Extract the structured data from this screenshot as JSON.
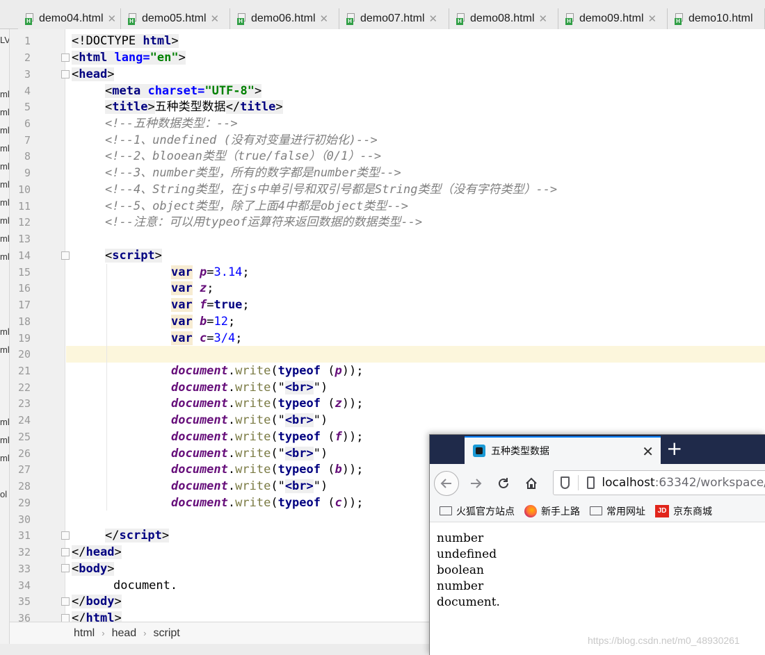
{
  "ide": {
    "tabs": [
      "demo04.html",
      "demo05.html",
      "demo06.html",
      "demo07.html",
      "demo08.html",
      "demo09.html",
      "demo10.html"
    ],
    "left_strip": [
      "LV",
      "ml",
      "ml",
      "ml",
      "ml",
      "ml",
      "ml",
      "ml",
      "ml",
      "ml",
      "ml",
      "ml",
      "ml",
      "ml",
      "ml",
      "ml",
      "ml",
      "ol"
    ],
    "line_numbers": [
      "1",
      "2",
      "3",
      "4",
      "5",
      "6",
      "7",
      "8",
      "9",
      "10",
      "11",
      "12",
      "13",
      "14",
      "15",
      "16",
      "17",
      "18",
      "19",
      "20",
      "21",
      "22",
      "23",
      "24",
      "25",
      "26",
      "27",
      "28",
      "29",
      "30",
      "31",
      "32",
      "33",
      "34",
      "35",
      "36"
    ],
    "code": {
      "l1": [
        "<!DOCTYPE ",
        "html",
        ">"
      ],
      "l2": [
        "<",
        "html",
        " ",
        "lang",
        "=",
        "\"en\"",
        ">"
      ],
      "l3": [
        "<",
        "head",
        ">"
      ],
      "l4": [
        "<",
        "meta",
        " ",
        "charset",
        "=",
        "\"UTF-8\"",
        ">"
      ],
      "l5": [
        "<",
        "title",
        ">",
        "五种类型数据",
        "</",
        "title",
        ">"
      ],
      "l6": "<!--五种数据类型：-->",
      "l7": "<!--1、undefined (没有对变量进行初始化)-->",
      "l8": "<!--2、blooean类型（true/false）（0/1）-->",
      "l9": "<!--3、number类型，所有的数字都是number类型-->",
      "l10": "<!--4、String类型，在js中单引号和双引号都是String类型（没有字符类型）-->",
      "l11": "<!--5、object类型，除了上面4中都是object类型-->",
      "l12": "<!--注意：可以用typeof运算符来返回数据的数据类型-->",
      "l14": [
        "<",
        "script",
        ">"
      ],
      "l15": [
        "var",
        " ",
        "p",
        "=",
        "3.14",
        ";"
      ],
      "l16": [
        "var",
        " ",
        "z",
        ";"
      ],
      "l17": [
        "var",
        " ",
        "f",
        "=",
        "true",
        ";"
      ],
      "l18": [
        "var",
        " ",
        "b",
        "=",
        "12",
        ";"
      ],
      "l19": [
        "var",
        " ",
        "c",
        "=",
        "3/4",
        ";"
      ],
      "l21": [
        "document",
        ".",
        "write",
        "(",
        "typeof",
        " (",
        "p",
        "));"
      ],
      "l22": [
        "document",
        ".",
        "write",
        "(\"",
        "<br>",
        "\")"
      ],
      "l23": [
        "document",
        ".",
        "write",
        "(",
        "typeof",
        " (",
        "z",
        "));"
      ],
      "l24": [
        "document",
        ".",
        "write",
        "(\"",
        "<br>",
        "\")"
      ],
      "l25": [
        "document",
        ".",
        "write",
        "(",
        "typeof",
        " (",
        "f",
        "));"
      ],
      "l26": [
        "document",
        ".",
        "write",
        "(\"",
        "<br>",
        "\")"
      ],
      "l27": [
        "document",
        ".",
        "write",
        "(",
        "typeof",
        " (",
        "b",
        "));"
      ],
      "l28": [
        "document",
        ".",
        "write",
        "(\"",
        "<br>",
        "\")"
      ],
      "l29": [
        "document",
        ".",
        "write",
        "(",
        "typeof",
        " (",
        "c",
        "));"
      ],
      "l31": [
        "</",
        "script",
        ">"
      ],
      "l32": [
        "</",
        "head",
        ">"
      ],
      "l33": [
        "<",
        "body",
        ">"
      ],
      "l34": "document.",
      "l35": [
        "</",
        "body",
        ">"
      ],
      "l36": [
        "</",
        "html",
        ">"
      ]
    },
    "breadcrumb": [
      "html",
      "head",
      "script"
    ]
  },
  "browser": {
    "tab_title": "五种类型数据",
    "tab_close": "✕",
    "new_tab": "+",
    "url_host": "localhost",
    "url_rest": ":63342/workspace/",
    "bookmarks": [
      "火狐官方站点",
      "新手上路",
      "常用网址",
      "京东商城"
    ],
    "jd_label": "JD",
    "output": [
      "number",
      "undefined",
      "boolean",
      "number",
      "document."
    ]
  },
  "watermark": "https://blog.csdn.net/m0_48930261",
  "colors": {
    "tag": "#000080",
    "attr": "#0000ff",
    "string": "#008000",
    "comment": "#808080",
    "number": "#0000ff",
    "current_line": "#fcf6dc",
    "browser_titlebar": "#1f2a4a"
  }
}
